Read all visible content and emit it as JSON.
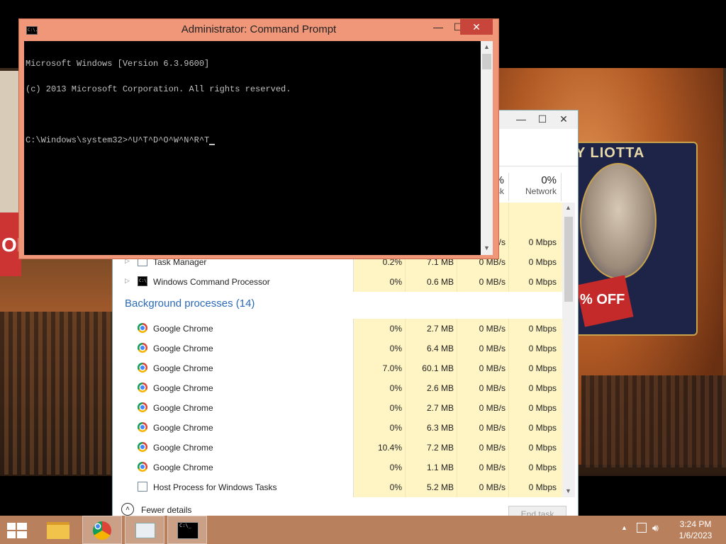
{
  "cmd_window": {
    "title": "Administrator:  Command Prompt",
    "icon_text": "C:\\.",
    "minimize": "—",
    "maximize": "☐",
    "close": "✕",
    "lines": [
      "Microsoft Windows [Version 6.3.9600]",
      "(c) 2013 Microsoft Corporation. All rights reserved.",
      "",
      "C:\\Windows\\system32>^U^T^D^O^W^N^R^T"
    ]
  },
  "task_manager": {
    "minimize": "—",
    "maximize": "☐",
    "close": "✕",
    "columns": {
      "disk": {
        "pct": "%",
        "label": "sk"
      },
      "network": {
        "pct": "0%",
        "label": "Network"
      }
    },
    "partial_row": {
      "network": "0 Mbps",
      "disk": "/s"
    },
    "app_rows": [
      {
        "name": "Task Manager",
        "cpu": "0.2%",
        "memory": "7.1 MB",
        "disk": "0 MB/s",
        "network": "0 Mbps"
      },
      {
        "name": "Windows Command Processor",
        "cpu": "0%",
        "memory": "0.6 MB",
        "disk": "0 MB/s",
        "network": "0 Mbps"
      }
    ],
    "background_title": "Background processes (14)",
    "background_rows": [
      {
        "name": "Google Chrome",
        "cpu": "0%",
        "memory": "2.7 MB",
        "disk": "0 MB/s",
        "network": "0 Mbps"
      },
      {
        "name": "Google Chrome",
        "cpu": "0%",
        "memory": "6.4 MB",
        "disk": "0 MB/s",
        "network": "0 Mbps"
      },
      {
        "name": "Google Chrome",
        "cpu": "7.0%",
        "memory": "60.1 MB",
        "disk": "0 MB/s",
        "network": "0 Mbps"
      },
      {
        "name": "Google Chrome",
        "cpu": "0%",
        "memory": "2.6 MB",
        "disk": "0 MB/s",
        "network": "0 Mbps"
      },
      {
        "name": "Google Chrome",
        "cpu": "0%",
        "memory": "2.7 MB",
        "disk": "0 MB/s",
        "network": "0 Mbps"
      },
      {
        "name": "Google Chrome",
        "cpu": "0%",
        "memory": "6.3 MB",
        "disk": "0 MB/s",
        "network": "0 Mbps"
      },
      {
        "name": "Google Chrome",
        "cpu": "10.4%",
        "memory": "7.2 MB",
        "disk": "0 MB/s",
        "network": "0 Mbps"
      },
      {
        "name": "Google Chrome",
        "cpu": "0%",
        "memory": "1.1 MB",
        "disk": "0 MB/s",
        "network": "0 Mbps"
      },
      {
        "name": "Host Process for Windows Tasks",
        "cpu": "0%",
        "memory": "5.2 MB",
        "disk": "0 MB/s",
        "network": "0 Mbps"
      }
    ],
    "fewer_details": "Fewer details",
    "end_task": "End task"
  },
  "wallpaper": {
    "label_text": "Y LIOTTA",
    "badge_text": "% OFF",
    "left_text": "ORE"
  },
  "taskbar": {
    "time": "3:24 PM",
    "date": "1/6/2023",
    "tray_arrow": "▲",
    "cmd_thumb_text": "C:\\_"
  },
  "colors": {
    "cmd_frame": "#f0977a",
    "close_red": "#c7453b",
    "taskbar": "#b9805e",
    "heat_low": "#fff4c4",
    "heat_mid": "#ffe8a0",
    "section_blue": "#2a6ab8"
  }
}
